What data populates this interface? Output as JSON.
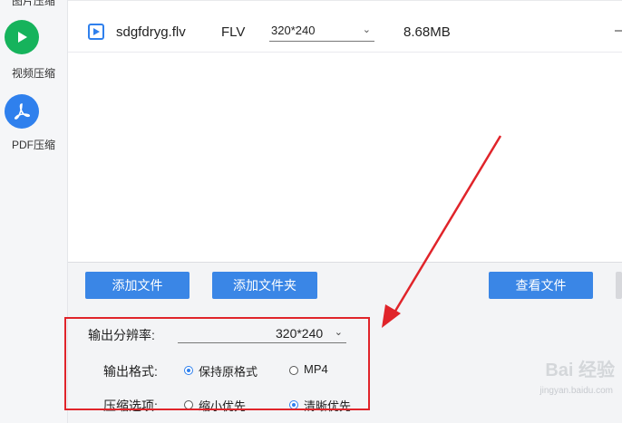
{
  "sidebar": {
    "items": [
      {
        "label": "图片压缩"
      },
      {
        "label": "视频压缩"
      },
      {
        "label": "PDF压缩"
      }
    ]
  },
  "file_list": {
    "rows": [
      {
        "name": "sdgfdryg.flv",
        "format": "FLV",
        "resolution": "320*240",
        "size": "8.68MB"
      }
    ]
  },
  "buttons": {
    "add_file": "添加文件",
    "add_folder": "添加文件夹",
    "view_files": "查看文件"
  },
  "settings": {
    "resolution_label": "输出分辨率:",
    "resolution_value": "320*240",
    "format_label": "输出格式:",
    "format_options": [
      {
        "label": "保持原格式",
        "checked": true
      },
      {
        "label": "MP4",
        "checked": false
      }
    ],
    "compress_label": "压缩选项:",
    "compress_options": [
      {
        "label": "缩小优先",
        "checked": false
      },
      {
        "label": "清晰优先",
        "checked": true
      }
    ]
  },
  "watermark": {
    "text": "Bai 经验",
    "sub": "jingyan.baidu.com"
  },
  "colors": {
    "accent": "#3a86e6",
    "highlight": "#e0242a",
    "video_icon": "#16b35c",
    "pdf_icon": "#2f80ed"
  }
}
